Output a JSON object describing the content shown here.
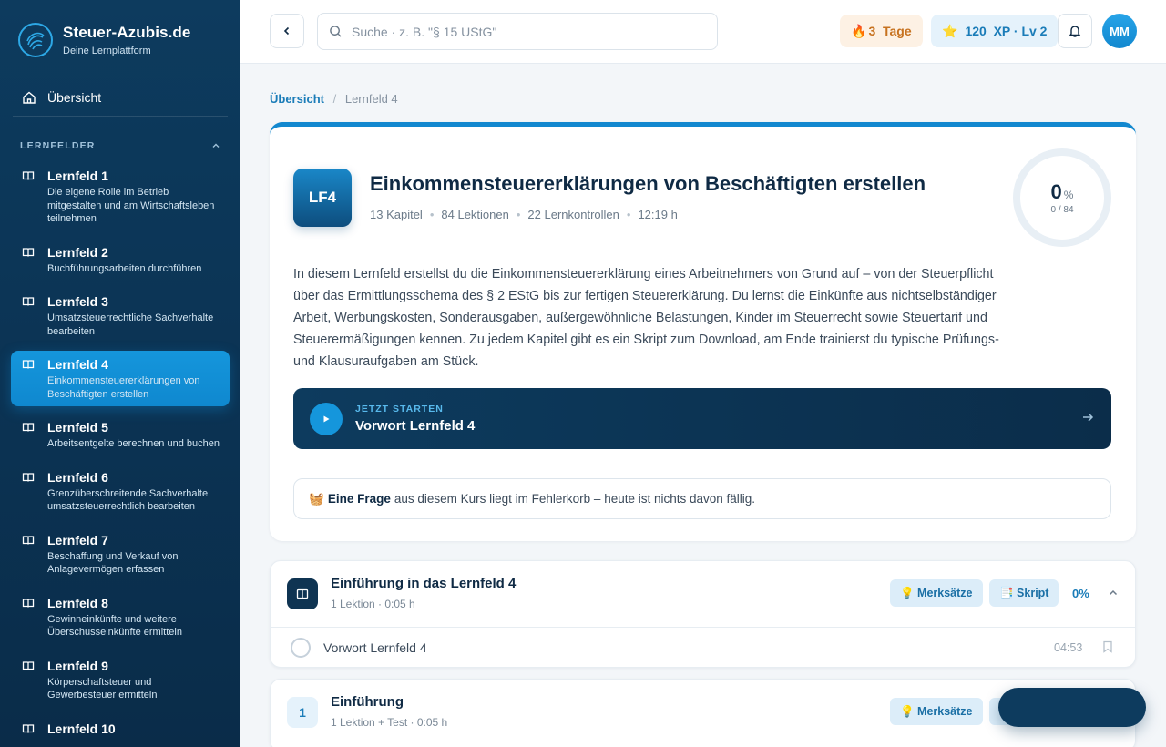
{
  "brand": {
    "title": "Steuer-Azubis.de",
    "subtitle": "Deine Lernplattform"
  },
  "sidebar": {
    "home_label": "Übersicht",
    "section_label": "LERNFELDER",
    "items": [
      {
        "title": "Lernfeld 1",
        "desc": "Die eigene Rolle im Betrieb mitgestalten und am Wirtschaftsleben teilnehmen"
      },
      {
        "title": "Lernfeld 2",
        "desc": "Buchführungsarbeiten durchführen"
      },
      {
        "title": "Lernfeld 3",
        "desc": "Umsatzsteuerrechtliche Sachverhalte bearbeiten"
      },
      {
        "title": "Lernfeld 4",
        "desc": "Einkommensteuererklärungen von Beschäftigten erstellen"
      },
      {
        "title": "Lernfeld 5",
        "desc": "Arbeitsentgelte berechnen und buchen"
      },
      {
        "title": "Lernfeld 6",
        "desc": "Grenzüberschreitende Sachverhalte umsatzsteuerrechtlich bearbeiten"
      },
      {
        "title": "Lernfeld 7",
        "desc": "Beschaffung und Verkauf von Anlagevermögen erfassen"
      },
      {
        "title": "Lernfeld 8",
        "desc": "Gewinneinkünfte und weitere Überschusseinkünfte ermitteln"
      },
      {
        "title": "Lernfeld 9",
        "desc": "Körperschaftsteuer und Gewerbesteuer ermitteln"
      },
      {
        "title": "Lernfeld 10",
        "desc": ""
      }
    ],
    "active_index": 3
  },
  "topbar": {
    "search_placeholder": "Suche · z. B. \"§ 15 UStG\"",
    "streak_label": "3  Tage",
    "streak_icon": "🔥",
    "xp_label": "120  XP · Lv 2",
    "xp_icon": "⭐",
    "avatar_initials": "MM"
  },
  "breadcrumb": {
    "home": "Übersicht",
    "sep": "/",
    "current": "Lernfeld 4"
  },
  "course": {
    "badge": "LF4",
    "title": "Einkommensteuererklärungen von Beschäftigten erstellen",
    "meta": [
      "13 Kapitel",
      "84 Lektionen",
      "22 Lernkontrollen",
      "12:19 h"
    ],
    "progress_pct": "0",
    "progress_unit": "%",
    "progress_count": "0 / 84",
    "description": "In diesem Lernfeld erstellst du die Einkommensteuererklärung eines Arbeitnehmers von Grund auf – von der Steuerpflicht über das Ermittlungsschema des § 2 EStG bis zur fertigen Steuererklärung. Du lernst die Einkünfte aus nichtselbständiger Arbeit, Werbungskosten, Sonderausgaben, außergewöhnliche Belastungen, Kinder im Steuerrecht sowie Steuertarif und Steuerermäßigungen kennen. Zu jedem Kapitel gibt es ein Skript zum Download, am Ende trainierst du typische Prüfungs- und Klausuraufgaben am Stück.",
    "start_kicker": "JETZT STARTEN",
    "start_title": "Vorwort Lernfeld 4",
    "fehler_icon": "🧺",
    "fehler_bold": "Eine Frage",
    "fehler_rest": "aus diesem Kurs liegt im Fehlerkorb – heute ist nichts davon fällig."
  },
  "chapters": [
    {
      "title": "Einführung in das Lernfeld 4",
      "sub": "1 Lektion · 0:05 h",
      "merk_label": "💡 Merksätze",
      "skript_label": "📑 Skript",
      "pct": "0%",
      "lessons": [
        {
          "title": "Vorwort Lernfeld 4",
          "duration": "04:53"
        }
      ]
    },
    {
      "number": "1",
      "title": "Einführung",
      "sub": "1 Lektion + Test · 0:05 h",
      "merk_label": "💡 Merksätze"
    }
  ]
}
